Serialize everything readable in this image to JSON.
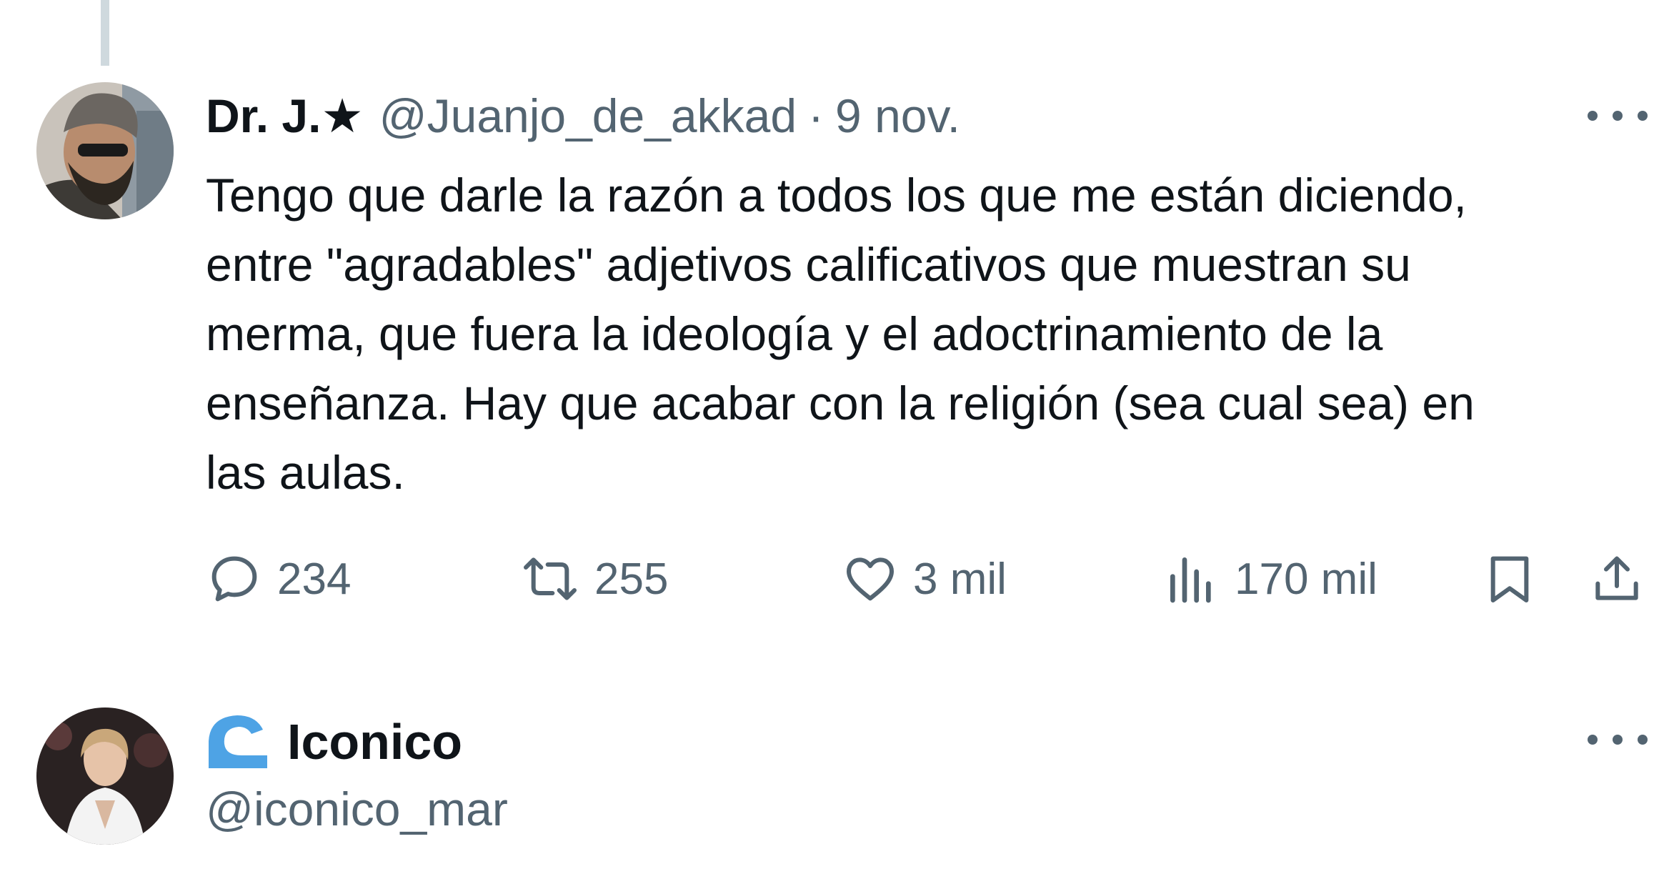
{
  "tweet": {
    "author_name": "Dr. J.",
    "author_badge": "★",
    "author_handle": "@Juanjo_de_akkad",
    "separator": "·",
    "timestamp": "9 nov.",
    "body": "Tengo que darle la razón a todos los que me están diciendo,\nentre \"agradables\" adjetivos calificativos que muestran su\nmerma, que fuera la ideología y el adoctrinamiento de la\nenseñanza. Hay que acabar con la religión (sea cual sea) en\nlas aulas.",
    "actions": {
      "replies": "234",
      "retweets": "255",
      "likes": "3 mil",
      "views": "170 mil"
    }
  },
  "next_profile": {
    "name": "Iconico",
    "handle": "@iconico_mar"
  },
  "icons": {
    "more": "more-horizontal-icon",
    "reply": "reply-icon",
    "retweet": "retweet-icon",
    "like": "heart-icon",
    "views": "views-chart-icon",
    "bookmark": "bookmark-icon",
    "share": "share-icon",
    "brand": "wave-logo-icon"
  },
  "colors": {
    "text_primary": "#0f1419",
    "text_secondary": "#536471",
    "thread_line": "#cfd9de",
    "brand_logo": "#4ea3e5"
  }
}
